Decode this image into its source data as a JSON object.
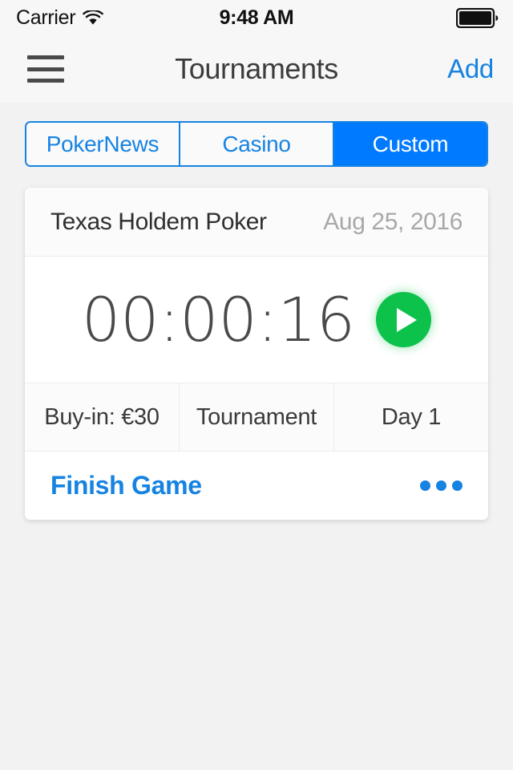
{
  "status_bar": {
    "carrier": "Carrier",
    "wifi_icon": "wifi-icon",
    "time": "9:48 AM",
    "battery_icon": "battery-full-icon"
  },
  "nav_bar": {
    "menu_icon": "hamburger-menu-icon",
    "title": "Tournaments",
    "add_label": "Add"
  },
  "segmented_control": {
    "selected_index": 2,
    "segments": [
      {
        "label": "PokerNews"
      },
      {
        "label": "Casino"
      },
      {
        "label": "Custom"
      }
    ]
  },
  "card": {
    "title": "Texas Holdem Poker",
    "date": "Aug 25, 2016",
    "timer": "00:00:16",
    "play_icon": "play-icon",
    "info": [
      {
        "label": "Buy-in: €30"
      },
      {
        "label": "Tournament"
      },
      {
        "label": "Day 1"
      }
    ],
    "finish_label": "Finish Game",
    "more_icon": "more-horizontal-icon"
  },
  "colors": {
    "accent_blue": "#007aff",
    "link_blue": "#1683e2",
    "play_green": "#0cc24b",
    "page_background": "#f2f2f2"
  }
}
